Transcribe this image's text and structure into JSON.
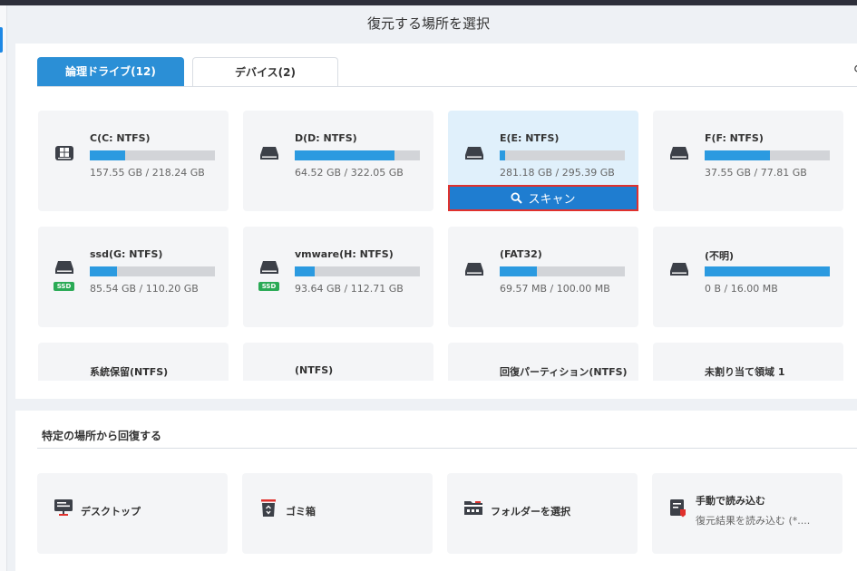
{
  "page_title": "復元する場所を選択",
  "tabs": [
    {
      "label": "論理ドライブ(12)",
      "active": true
    },
    {
      "label": "デバイス(2)",
      "active": false
    }
  ],
  "drives": [
    {
      "name": "C(C: NTFS)",
      "size": "157.55 GB / 218.24 GB",
      "usage": 0.28,
      "icon": "windows-drive-icon"
    },
    {
      "name": "D(D: NTFS)",
      "size": "64.52 GB / 322.05 GB",
      "usage": 0.8,
      "icon": "hard-drive-icon"
    },
    {
      "name": "E(E: NTFS)",
      "size": "281.18 GB / 295.39 GB",
      "usage": 0.04,
      "icon": "hard-drive-icon",
      "selected": true
    },
    {
      "name": "F(F: NTFS)",
      "size": "37.55 GB / 77.81 GB",
      "usage": 0.52,
      "icon": "hard-drive-icon"
    },
    {
      "name": "ssd(G: NTFS)",
      "size": "85.54 GB / 110.20 GB",
      "usage": 0.22,
      "icon": "hard-drive-icon",
      "badge": "SSD"
    },
    {
      "name": "vmware(H: NTFS)",
      "size": "93.64 GB / 112.71 GB",
      "usage": 0.16,
      "icon": "hard-drive-icon",
      "badge": "SSD"
    },
    {
      "name": "(FAT32)",
      "size": "69.57 MB / 100.00 MB",
      "usage": 0.3,
      "icon": "hard-drive-icon"
    },
    {
      "name": "(不明)",
      "size": "0 B / 16.00 MB",
      "usage": 1.0,
      "icon": "hard-drive-icon"
    },
    {
      "name": "系統保留(NTFS)"
    },
    {
      "name": "(NTFS)"
    },
    {
      "name": "回復パーティション(NTFS)"
    },
    {
      "name": "未割り当て領域 1"
    }
  ],
  "scan_button": {
    "label": "スキャン",
    "icon": "search-icon"
  },
  "locations_section": {
    "title": "特定の場所から回復する",
    "items": [
      {
        "label": "デスクトップ",
        "icon": "desktop-icon"
      },
      {
        "label": "ゴミ箱",
        "icon": "recycle-bin-icon"
      },
      {
        "label": "フォルダーを選択",
        "icon": "folder-icon"
      },
      {
        "label": "手動で読み込む",
        "sub": "復元結果を読み込む (*....",
        "icon": "manual-load-icon"
      }
    ]
  },
  "colors": {
    "accent": "#2b8fd6",
    "bar": "#2b9ae0",
    "highlight_border": "#e0312d",
    "ssd_badge": "#2aaa55"
  }
}
